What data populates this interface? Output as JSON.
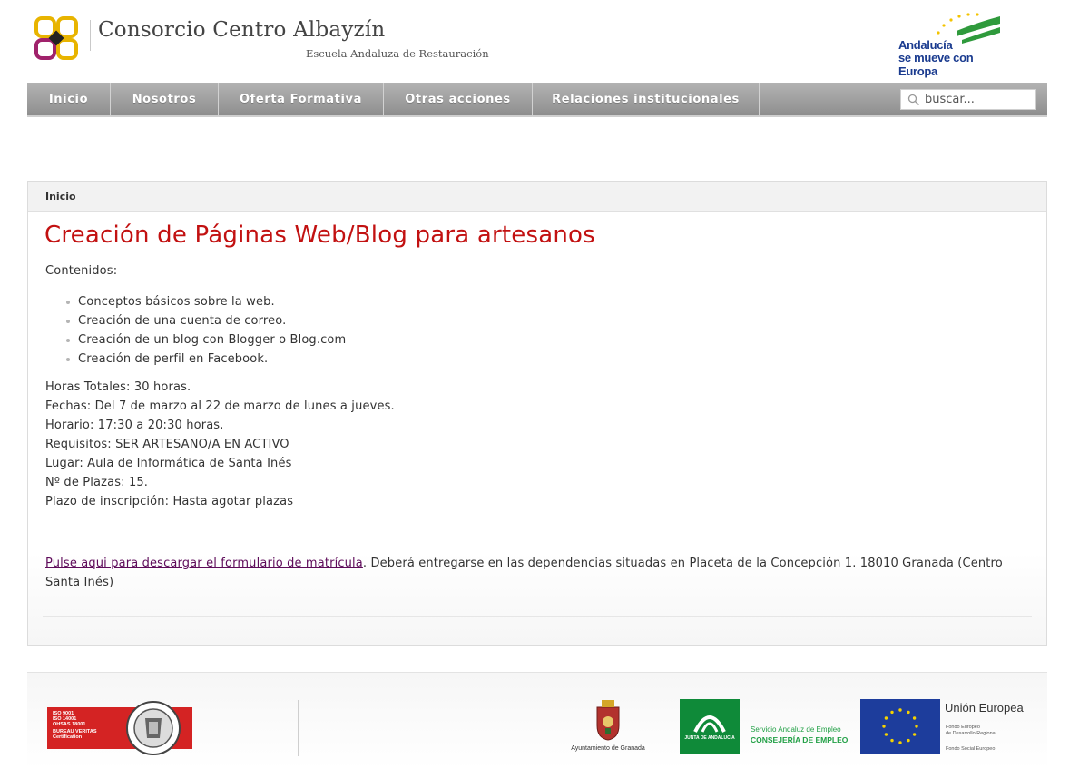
{
  "header": {
    "site_title": "Consorcio Centro Albayzín",
    "site_subtitle": "Escuela Andaluza de Restauración",
    "partner_logo": {
      "line1": "Andalucía",
      "line2": "se mueve con Europa"
    }
  },
  "nav": {
    "items": [
      {
        "label": "Inicio"
      },
      {
        "label": "Nosotros"
      },
      {
        "label": "Oferta Formativa"
      },
      {
        "label": "Otras acciones"
      },
      {
        "label": "Relaciones institucionales"
      }
    ],
    "search_placeholder": "buscar..."
  },
  "main": {
    "breadcrumb": "Inicio",
    "title": "Creación de Páginas Web/Blog para artesanos",
    "contents_label": "Contenidos:",
    "contents": [
      "Conceptos básicos sobre la web.",
      "Creación de una cuenta de correo.",
      "Creación de un blog con Blogger o Blog.com",
      "Creación de perfil en Facebook."
    ],
    "details": [
      "Horas Totales: 30 horas.",
      "Fechas: Del 7 de marzo al 22 de marzo de lunes a jueves.",
      "Horario: 17:30 a 20:30 horas.",
      "Requisitos: SER ARTESANO/A EN ACTIVO",
      "Lugar: Aula de Informática de Santa Inés",
      "Nº de Plazas: 15.",
      "Plazo de inscripción: Hasta agotar plazas"
    ],
    "download_link": "Pulse aqui para descargar el formulario de matrícula",
    "download_note": ". Deberá entregarse en las dependencias situadas en Placeta de la Concepción 1. 18010 Granada (Centro Santa Inés)"
  },
  "footer": {
    "certification_lines": [
      "ISO 9001",
      "ISO 14001",
      "OHSAS 18001",
      "BUREAU VERITAS",
      "Certification"
    ],
    "ayuntamiento_label": "Ayuntamiento de Granada",
    "junta_label": "JUNTA DE ANDALUCIA",
    "sae_line1": "Servicio Andaluz de Empleo",
    "sae_line2": "CONSEJERÍA DE EMPLEO",
    "eu_title": "Unión Europea",
    "eu_sub1": "Fondo Europeo",
    "eu_sub2": "de Desarrollo Regional",
    "eu_sub3": "Fondo Social Europeo"
  },
  "colors": {
    "title_red": "#c21111",
    "nav_gray": "#9d9d9d",
    "link_purple": "#5e0b5a",
    "andalucia_blue": "#1a3b8f",
    "andalucia_green": "#2f9a3c"
  }
}
